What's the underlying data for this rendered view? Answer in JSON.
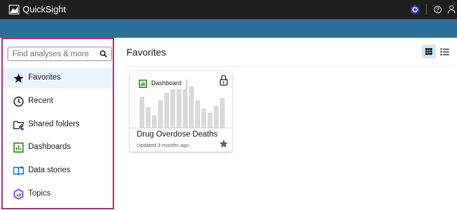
{
  "app": {
    "name": "QuickSight"
  },
  "topbar": {
    "icons": [
      "quicksight-logo-icon",
      "user-hexagon-icon",
      "help-icon",
      "user-icon"
    ],
    "accent": "#3b48cc"
  },
  "sidebar": {
    "search": {
      "placeholder": "Find analyses & more",
      "value": ""
    },
    "items": [
      {
        "label": "Favorites",
        "icon": "star-icon",
        "active": true
      },
      {
        "label": "Recent",
        "icon": "clock-icon"
      },
      {
        "label": "Shared folders",
        "icon": "shared-folder-icon"
      },
      {
        "label": "Dashboards",
        "icon": "dashboard-icon"
      },
      {
        "label": "Data stories",
        "icon": "book-icon"
      },
      {
        "label": "Topics",
        "icon": "topic-icon"
      }
    ]
  },
  "main": {
    "title": "Favorites",
    "view_modes": [
      "grid-view-icon",
      "list-view-icon"
    ],
    "cards": [
      {
        "type_label": "Dashboard",
        "title": "Drug Overdose Deaths",
        "updated": "Updated 3 months ago",
        "favorite": true,
        "locked": true
      }
    ]
  },
  "colors": {
    "topbar": "#1f1f1f",
    "bluebar": "#2e6f98",
    "highlight_border": "#b5287b",
    "dashboard_green": "#1d8102",
    "active_bg": "#e9f3fb"
  }
}
